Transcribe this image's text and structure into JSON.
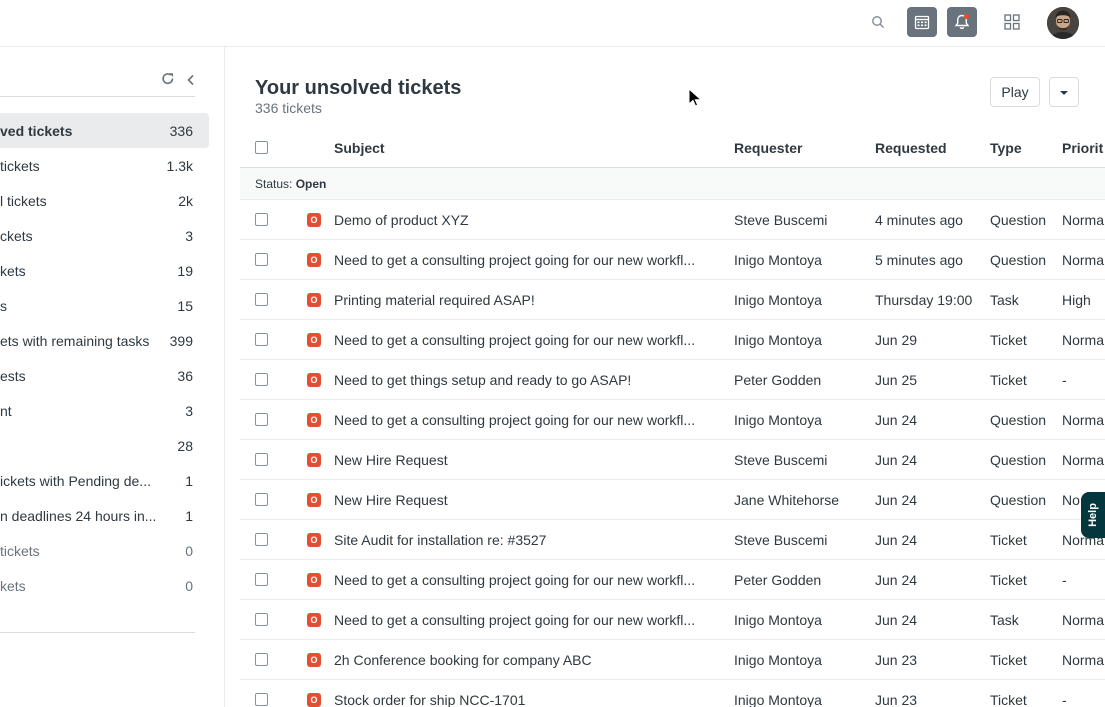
{
  "sidebar": {
    "items": [
      {
        "label": "ved tickets",
        "count": "336",
        "active": true
      },
      {
        "label": " tickets",
        "count": "1.3k"
      },
      {
        "label": "l tickets",
        "count": "2k"
      },
      {
        "label": "ckets",
        "count": "3"
      },
      {
        "label": "kets",
        "count": "19"
      },
      {
        "label": "s",
        "count": "15"
      },
      {
        "label": "ets with remaining tasks",
        "count": "399"
      },
      {
        "label": "ests",
        "count": "36"
      },
      {
        "label": "nt",
        "count": "3"
      },
      {
        "label": "",
        "count": "28"
      },
      {
        "label": "ickets with Pending de...",
        "count": "1"
      },
      {
        "label": "n deadlines 24 hours in...",
        "count": "1"
      },
      {
        "label": " tickets",
        "count": "0",
        "muted": true
      },
      {
        "label": "kets",
        "count": "0",
        "muted": true
      }
    ]
  },
  "main": {
    "title": "Your unsolved tickets",
    "subtitle": "336 tickets",
    "play_label": "Play"
  },
  "table": {
    "headers": {
      "subject": "Subject",
      "requester": "Requester",
      "requested": "Requested",
      "type": "Type",
      "priority": "Priorit"
    },
    "group_label": "Status:",
    "group_value": "Open",
    "status_letter": "O",
    "rows": [
      {
        "subject": "Demo of product XYZ",
        "requester": "Steve Buscemi",
        "requested": "4 minutes ago",
        "type": "Question",
        "priority": "Norma"
      },
      {
        "subject": "Need to get a consulting project going for our new workfl...",
        "requester": "Inigo Montoya",
        "requested": "5 minutes ago",
        "type": "Question",
        "priority": "Norma"
      },
      {
        "subject": "Printing material required ASAP!",
        "requester": "Inigo Montoya",
        "requested": "Thursday 19:00",
        "type": "Task",
        "priority": "High"
      },
      {
        "subject": "Need to get a consulting project going for our new workfl...",
        "requester": "Inigo Montoya",
        "requested": "Jun 29",
        "type": "Ticket",
        "priority": "Norma"
      },
      {
        "subject": "Need to get things setup and ready to go ASAP!",
        "requester": "Peter Godden",
        "requested": "Jun 25",
        "type": "Ticket",
        "priority": "-"
      },
      {
        "subject": "Need to get a consulting project going for our new workfl...",
        "requester": "Inigo Montoya",
        "requested": "Jun 24",
        "type": "Question",
        "priority": "Norma"
      },
      {
        "subject": "New Hire Request",
        "requester": "Steve Buscemi",
        "requested": "Jun 24",
        "type": "Question",
        "priority": "Norma"
      },
      {
        "subject": "New Hire Request",
        "requester": "Jane Whitehorse",
        "requested": "Jun 24",
        "type": "Question",
        "priority": "No"
      },
      {
        "subject": "Site Audit for installation re: #3527",
        "requester": "Steve Buscemi",
        "requested": "Jun 24",
        "type": "Ticket",
        "priority": "Norma"
      },
      {
        "subject": "Need to get a consulting project going for our new workfl...",
        "requester": "Peter Godden",
        "requested": "Jun 24",
        "type": "Ticket",
        "priority": "-"
      },
      {
        "subject": "Need to get a consulting project going for our new workfl...",
        "requester": "Inigo Montoya",
        "requested": "Jun 24",
        "type": "Task",
        "priority": "Norma"
      },
      {
        "subject": "2h Conference booking for company ABC",
        "requester": "Inigo Montoya",
        "requested": "Jun 23",
        "type": "Ticket",
        "priority": "Norma"
      },
      {
        "subject": "Stock order for ship NCC-1701",
        "requester": "Inigo Montoya",
        "requested": "Jun 23",
        "type": "Ticket",
        "priority": "-"
      }
    ]
  },
  "help": {
    "label": "Help"
  },
  "colors": {
    "status_open": "#e34f32",
    "topbar_icon_bg": "#68737d",
    "help_bg": "#03363d"
  }
}
